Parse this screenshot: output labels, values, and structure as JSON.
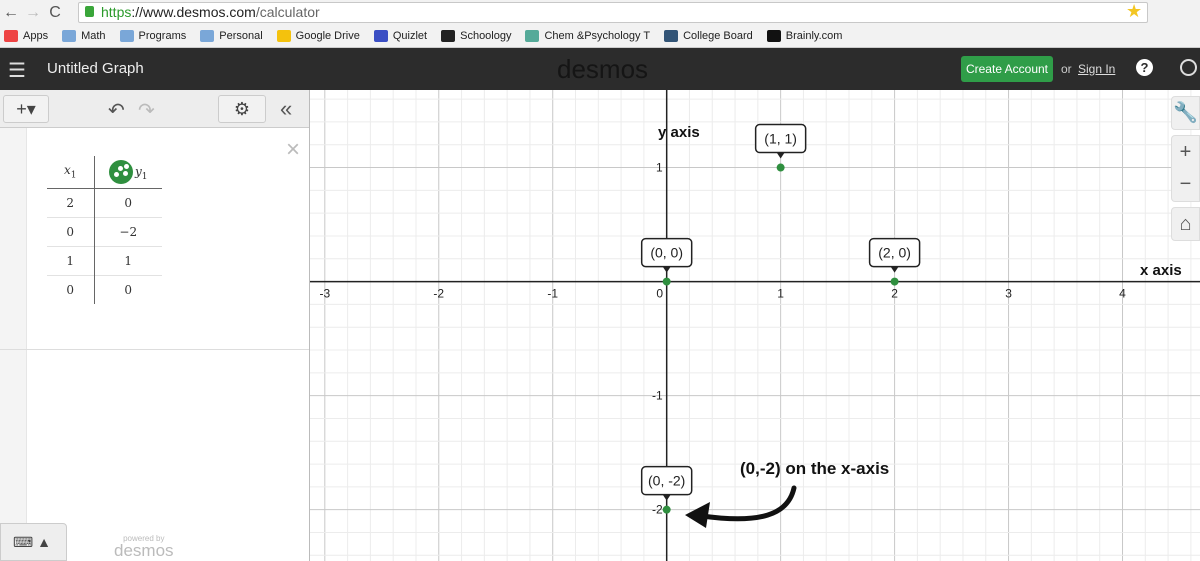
{
  "browser": {
    "url_scheme": "https",
    "url_host": "://www.desmos.com",
    "url_path": "/calculator",
    "bookmarks": [
      {
        "label": "Apps",
        "color": "#e44"
      },
      {
        "label": "Math",
        "color": "#7aa7d8"
      },
      {
        "label": "Programs",
        "color": "#7aa7d8"
      },
      {
        "label": "Personal",
        "color": "#7aa7d8"
      },
      {
        "label": "Google Drive",
        "color": "#f4c20d"
      },
      {
        "label": "Quizlet",
        "color": "#3b4fc4"
      },
      {
        "label": "Schoology",
        "color": "#222"
      },
      {
        "label": "Chem &Psychology T",
        "color": "#5a9"
      },
      {
        "label": "College Board",
        "color": "#357"
      },
      {
        "label": "Brainly.com",
        "color": "#111"
      }
    ]
  },
  "header": {
    "title": "Untitled Graph",
    "logo": "desmos",
    "create_account": "Create Account",
    "or": "or",
    "sign_in": "Sign In",
    "help": "?"
  },
  "sidebar": {
    "add": "+▾",
    "undo": "↶",
    "redo": "↷",
    "settings": "⚙",
    "collapse": "«",
    "close": "×",
    "table": {
      "x_header": "x",
      "x_sub": "1",
      "y_header": "y",
      "y_sub": "1",
      "rows": [
        [
          "2",
          "0"
        ],
        [
          "0",
          "−2"
        ],
        [
          "1",
          "1"
        ],
        [
          "0",
          "0"
        ]
      ]
    },
    "keyboard": "⌨ ▲",
    "powered_small": "powered by",
    "powered_logo": "desmos"
  },
  "graph": {
    "xrange": [
      -3.13,
      4.68
    ],
    "yrange": [
      -2.45,
      1.68
    ],
    "x_ticks": [
      "-3",
      "-2",
      "-1",
      "0",
      "1",
      "2",
      "3",
      "4"
    ],
    "y_ticks": [
      "1",
      "-1",
      "-2"
    ],
    "x_label": "x axis",
    "y_label": "y axis",
    "point_color": "#2f8f3f",
    "points": [
      {
        "x": 0,
        "y": 0,
        "label": "(0, 0)"
      },
      {
        "x": 1,
        "y": 1,
        "label": "(1, 1)"
      },
      {
        "x": 2,
        "y": 0,
        "label": "(2, 0)"
      },
      {
        "x": 0,
        "y": -2,
        "label": "(0, -2)"
      }
    ],
    "annotation": "(0,-2) on the x-axis"
  },
  "controls": {
    "wrench": "🔧",
    "zoom_in": "+",
    "zoom_out": "−",
    "home": "⌂"
  }
}
